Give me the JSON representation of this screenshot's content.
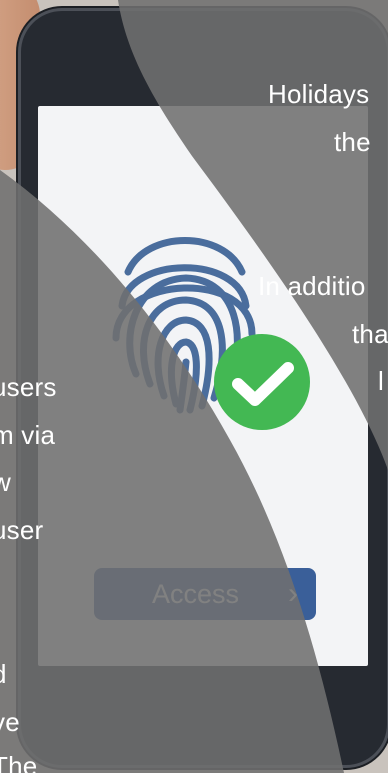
{
  "colors": {
    "overlay": "#707070",
    "accent": "#3a5f99",
    "success": "#43b853",
    "fingerprint": "#4a6d9d"
  },
  "icons": {
    "fingerprint": "fingerprint-icon",
    "check": "check-circle-icon",
    "chevron": "chevron-right-icon"
  },
  "phone_screen": {
    "access_button_label": "Access",
    "access_chevron": "›"
  },
  "overlay_text_right": {
    "line1": "Holidays",
    "line2": "the",
    "line3": "In additio",
    "line4": "tha",
    "line5": "l"
  },
  "overlay_text_left": {
    "line1": "users",
    "line2": "m via",
    "line3": "w",
    "line4": "user",
    "line5": "d",
    "line6": "ve",
    "line7": "The"
  }
}
